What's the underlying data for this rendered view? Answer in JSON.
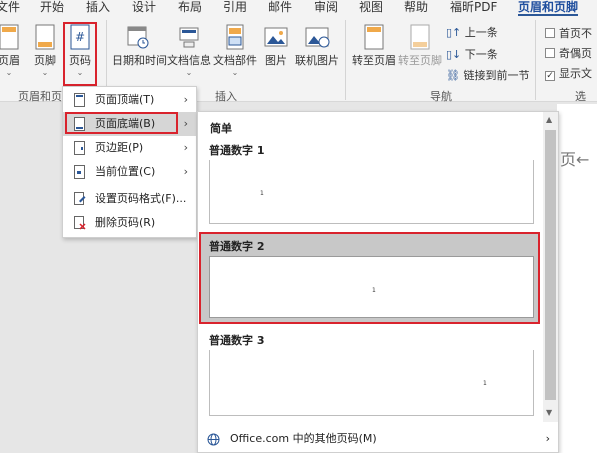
{
  "ribbon_tabs": [
    {
      "label": "文件"
    },
    {
      "label": "开始"
    },
    {
      "label": "插入"
    },
    {
      "label": "设计"
    },
    {
      "label": "布局"
    },
    {
      "label": "引用"
    },
    {
      "label": "邮件"
    },
    {
      "label": "审阅"
    },
    {
      "label": "视图"
    },
    {
      "label": "帮助"
    },
    {
      "label": "福昕PDF"
    },
    {
      "label": "页眉和页脚"
    }
  ],
  "ribbon": {
    "header_label": "页眉",
    "footer_label": "页脚",
    "page_number_label": "页码",
    "date_time_label": "日期和时间",
    "doc_info_label": "文档信息",
    "doc_parts_label": "文档部件",
    "picture_label": "图片",
    "online_picture_label": "联机图片",
    "goto_header_label": "转至页眉",
    "goto_footer_label": "转至页脚",
    "prev_label": "上一条",
    "next_label": "下一条",
    "link_prev_label": "链接到前一节",
    "first_page_label": "首页不",
    "odd_even_label": "奇偶页",
    "show_doc_text_label": "显示文",
    "group_header_footer": "页眉和页脚",
    "group_insert": "插入",
    "group_nav": "导航",
    "group_options": "选"
  },
  "menu": [
    {
      "label": "页面顶端(T)"
    },
    {
      "label": "页面底端(B)"
    },
    {
      "label": "页边距(P)"
    },
    {
      "label": "当前位置(C)"
    },
    {
      "label": "设置页码格式(F)..."
    },
    {
      "label": "删除页码(R)"
    }
  ],
  "submenu": {
    "section": "简单",
    "items": [
      {
        "title": "普通数字 1",
        "num": "1"
      },
      {
        "title": "普通数字 2",
        "num": "1"
      },
      {
        "title": "普通数字 3",
        "num": "1"
      }
    ],
    "more": "Office.com 中的其他页码(M)"
  },
  "document": {
    "page_text": "页←"
  }
}
